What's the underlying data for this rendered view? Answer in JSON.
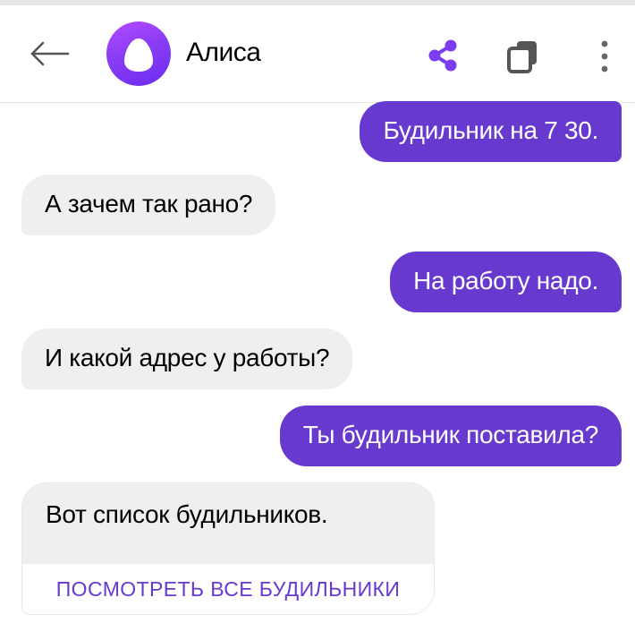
{
  "header": {
    "title": "Алиса",
    "back_icon": "arrow-left-icon",
    "avatar_icon": "alice-ring-icon",
    "share_icon": "share-icon",
    "copy_icon": "copy-icon",
    "more_icon": "more-vertical-icon"
  },
  "messages": [
    {
      "from": "user",
      "text": "Будильник на 7 30."
    },
    {
      "from": "alice",
      "text": "А зачем так рано?"
    },
    {
      "from": "user",
      "text": "На работу надо."
    },
    {
      "from": "alice",
      "text": "И какой адрес у работы?"
    },
    {
      "from": "user",
      "text": "Ты будильник поставила?"
    }
  ],
  "card": {
    "text": "Вот список будильников.",
    "action_label": "ПОСМОТРЕТЬ ВСЕ БУДИЛЬНИКИ"
  },
  "colors": {
    "accent": "#6839cf",
    "alice_bubble": "#efeff1",
    "avatar_gradient_start": "#b44cff",
    "avatar_gradient_end": "#6c2cf0"
  }
}
